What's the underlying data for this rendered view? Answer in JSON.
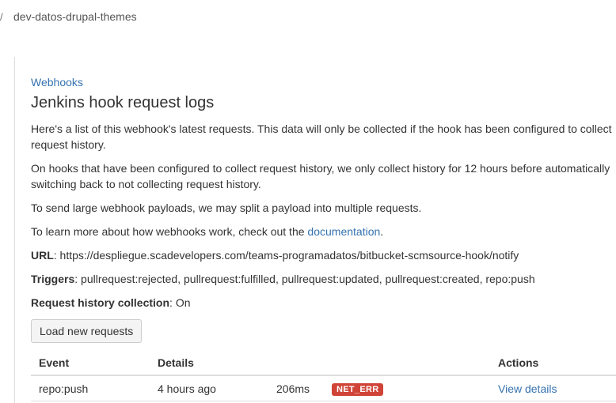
{
  "header": {
    "separator": "/",
    "repo_name": "dev-datos-drupal-themes"
  },
  "breadcrumb": {
    "label": "Webhooks"
  },
  "page": {
    "title": "Jenkins hook request logs",
    "para1": "Here's a list of this webhook's latest requests. This data will only be collected if the hook has been configured to collect request history.",
    "para2": "On hooks that have been configured to collect request history, we only collect history for 12 hours before automatically switching back to not collecting request history.",
    "para3": "To send large webhook payloads, we may split a payload into multiple requests.",
    "para4_prefix": "To learn more about how webhooks work, check out the ",
    "para4_link": "documentation",
    "para4_suffix": "."
  },
  "info": {
    "url_label": "URL",
    "url_value": ": https://despliegue.scadevelopers.com/teams-programadatos/bitbucket-scmsource-hook/notify",
    "triggers_label": "Triggers",
    "triggers_value": ": pullrequest:rejected, pullrequest:fulfilled, pullrequest:updated, pullrequest:created, repo:push",
    "history_label": "Request history collection",
    "history_value": ": On"
  },
  "buttons": {
    "load_new": "Load new requests"
  },
  "table": {
    "headers": {
      "event": "Event",
      "details": "Details",
      "actions": "Actions"
    },
    "rows": [
      {
        "event": "repo:push",
        "details": "4 hours ago",
        "duration": "206ms",
        "status": "NET_ERR",
        "action": "View details"
      }
    ]
  },
  "colors": {
    "link": "#3572b0",
    "error_badge": "#d04437"
  }
}
